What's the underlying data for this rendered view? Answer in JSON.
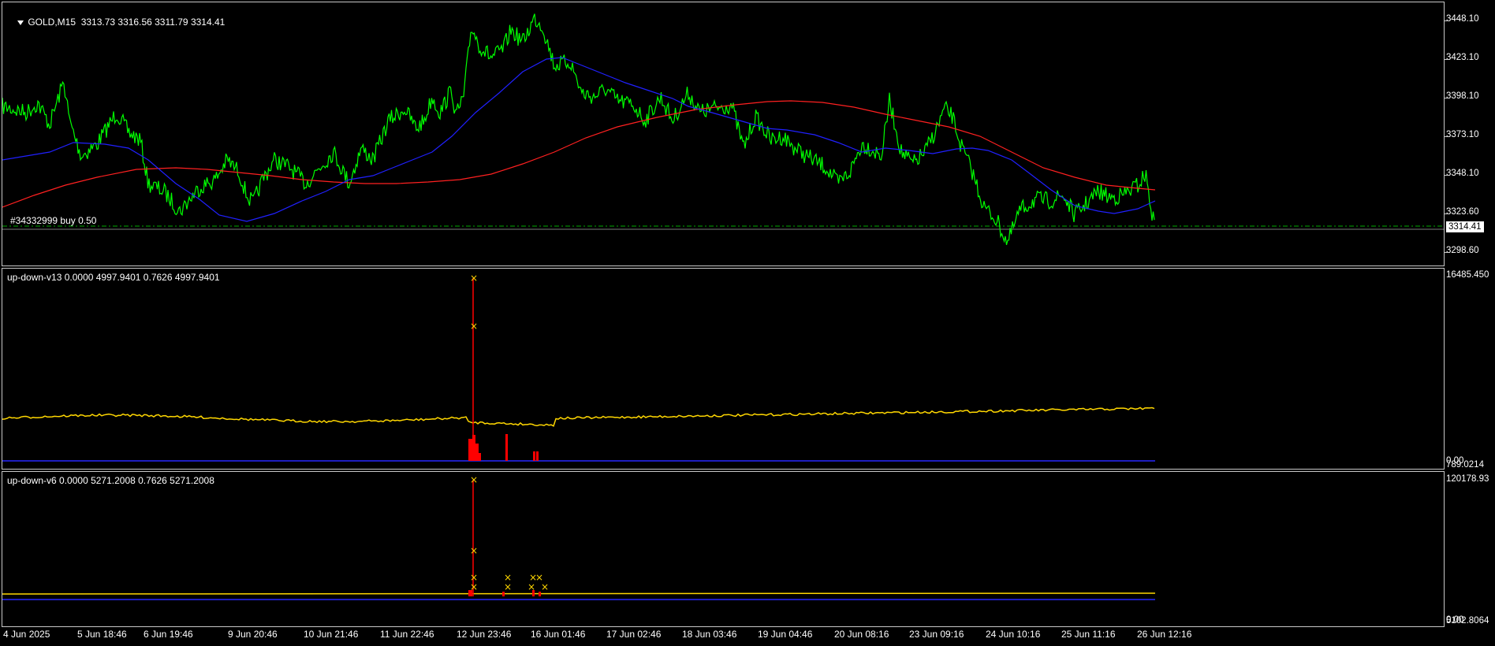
{
  "main_pane": {
    "title": "GOLD,M15  3313.73 3316.56 3311.79 3314.41",
    "order_label": "#34332999 buy 0.50",
    "current_price": "3314.41",
    "price_labels": [
      "3448.10",
      "3423.10",
      "3398.10",
      "3373.10",
      "3348.10",
      "3323.60",
      "3298.60"
    ],
    "colors": {
      "price": "#00ff00",
      "ma_fast": "#2020ff",
      "ma_slow": "#ff2020",
      "order_line": "#00aa00"
    }
  },
  "indicator1": {
    "title": "up-down-v13 0.0000 4997.9401 0.7626 4997.9401",
    "scale_labels": [
      "16485.450",
      "0.00",
      "789.0214"
    ]
  },
  "indicator2": {
    "title": "up-down-v6 0.0000 5271.2008 0.7626 5271.2008",
    "scale_labels": [
      "120178.93",
      "0.00",
      "5102.8064"
    ]
  },
  "time_labels": [
    "4 Jun 2025",
    "5 Jun 18:46",
    "6 Jun 19:46",
    "9 Jun 20:46",
    "10 Jun 21:46",
    "11 Jun 22:46",
    "12 Jun 23:46",
    "16 Jun 01:46",
    "17 Jun 02:46",
    "18 Jun 03:46",
    "19 Jun 04:46",
    "20 Jun 08:16",
    "23 Jun 09:16",
    "24 Jun 10:16",
    "25 Jun 11:16",
    "26 Jun 12:16"
  ]
}
